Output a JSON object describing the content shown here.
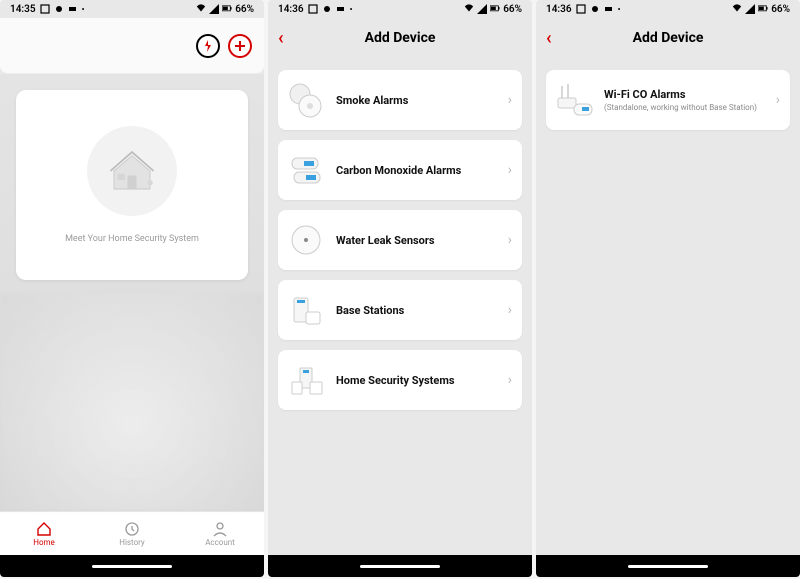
{
  "status": {
    "time1": "14:35",
    "time2": "14:36",
    "time3": "14:36",
    "battery": "66%"
  },
  "screen1": {
    "tagline": "Meet Your Home Security System",
    "tabs": {
      "home": "Home",
      "history": "History",
      "account": "Account"
    }
  },
  "screen2": {
    "title": "Add Device",
    "items": [
      {
        "label": "Smoke Alarms"
      },
      {
        "label": "Carbon Monoxide Alarms"
      },
      {
        "label": "Water Leak Sensors"
      },
      {
        "label": "Base Stations"
      },
      {
        "label": "Home Security Systems"
      }
    ]
  },
  "screen3": {
    "title": "Add Device",
    "items": [
      {
        "label": "Wi-Fi CO Alarms",
        "sub": "(Standalone, working without Base Station)"
      }
    ]
  }
}
